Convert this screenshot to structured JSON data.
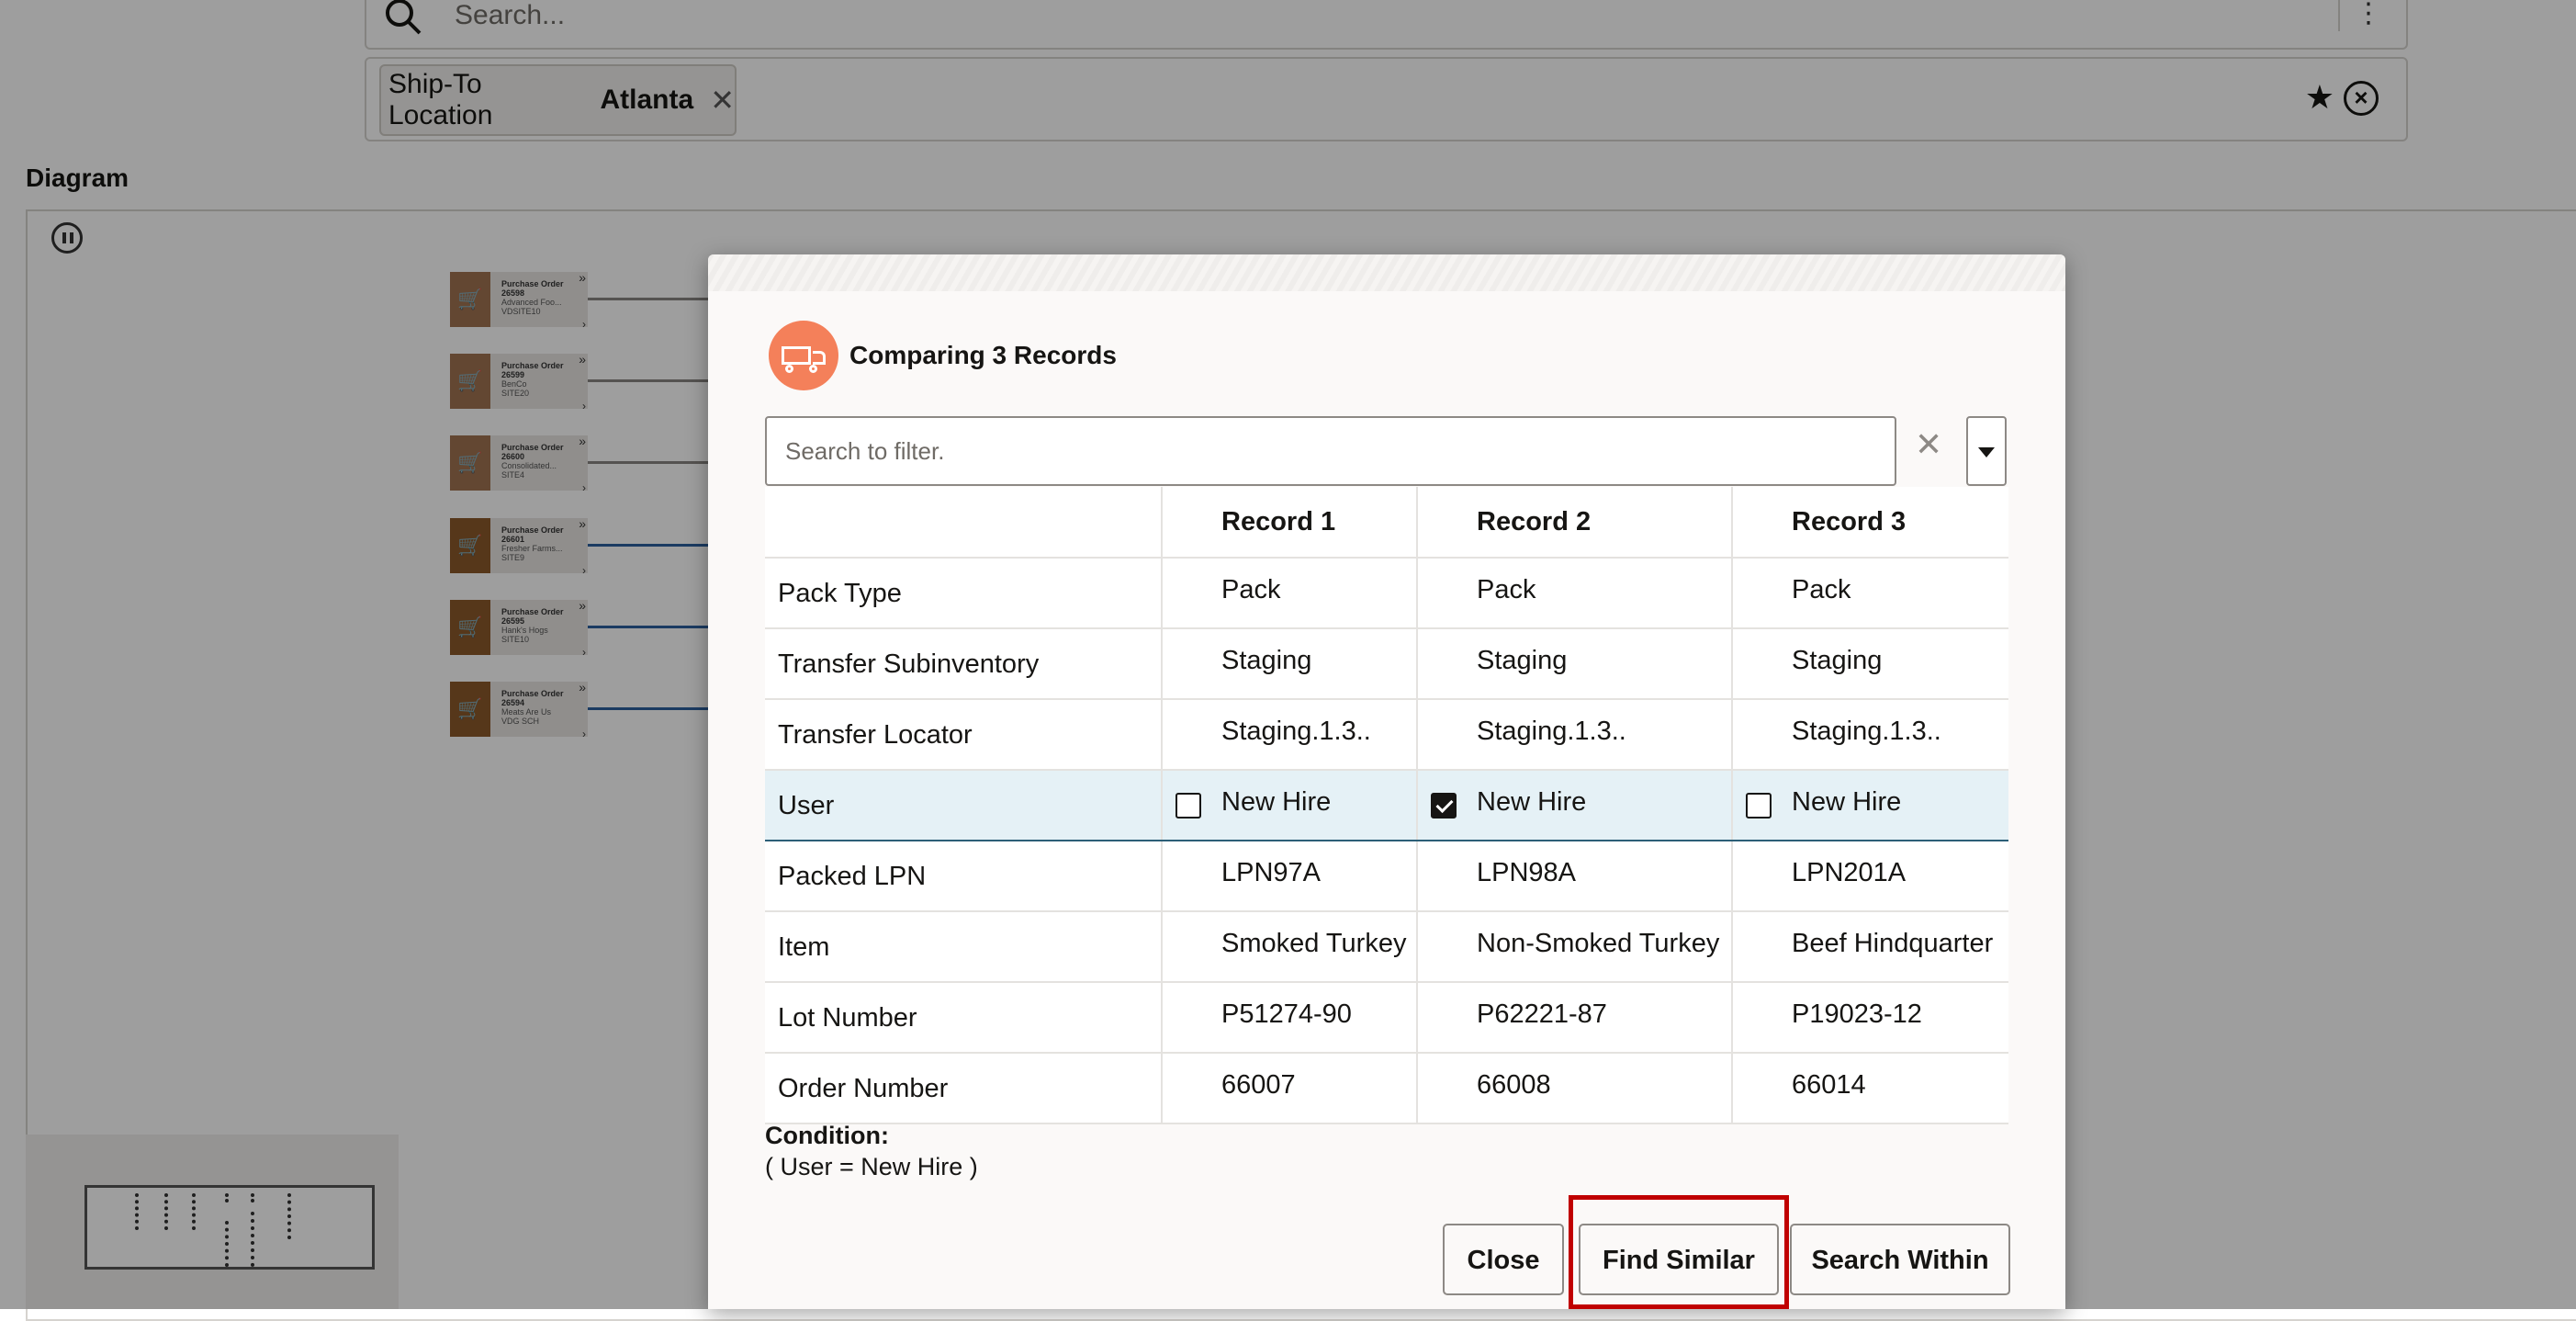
{
  "search": {
    "placeholder": "Search...",
    "menu_icon": "kebab-icon"
  },
  "filter_chip": {
    "label": "Ship-To Location",
    "value": "Atlanta"
  },
  "diagram": {
    "title": "Diagram",
    "nodes": [
      {
        "title": "Purchase Order",
        "number": "26598",
        "vendor": "Advanced Foo...",
        "site": "VDSITE10"
      },
      {
        "title": "Purchase Order",
        "number": "26599",
        "vendor": "BenCo",
        "site": "SITE20"
      },
      {
        "title": "Purchase Order",
        "number": "26600",
        "vendor": "Consolidated...",
        "site": "SITE4"
      },
      {
        "title": "Purchase Order",
        "number": "26601",
        "vendor": "Fresher Farms...",
        "site": "SITE9"
      },
      {
        "title": "Purchase Order",
        "number": "26595",
        "vendor": "Hank's Hogs",
        "site": "SITE10"
      },
      {
        "title": "Purchase Order",
        "number": "26594",
        "vendor": "Meats Are Us",
        "site": "VDG SCH"
      }
    ]
  },
  "dialog": {
    "title": "Comparing 3 Records",
    "filter_placeholder": "Search to filter.",
    "columns": [
      "",
      "Record 1",
      "Record 2",
      "Record 3"
    ],
    "rows": [
      {
        "field": "Pack Type",
        "values": [
          "Pack",
          "Pack",
          "Pack"
        ]
      },
      {
        "field": "Transfer Subinventory",
        "values": [
          "Staging",
          "Staging",
          "Staging"
        ]
      },
      {
        "field": "Transfer Locator",
        "values": [
          "Staging.1.3..",
          "Staging.1.3..",
          "Staging.1.3.."
        ]
      },
      {
        "field": "User",
        "values": [
          "New Hire",
          "New Hire",
          "New Hire"
        ],
        "checked": [
          false,
          true,
          false
        ]
      },
      {
        "field": "Packed LPN",
        "values": [
          "LPN97A",
          "LPN98A",
          "LPN201A"
        ]
      },
      {
        "field": "Item",
        "values": [
          "Smoked Turkey",
          "Non-Smoked Turkey",
          "Beef Hindquarter"
        ]
      },
      {
        "field": "Lot Number",
        "values": [
          "P51274-90",
          "P62221-87",
          "P19023-12"
        ]
      },
      {
        "field": "Order Number",
        "values": [
          "66007",
          "66008",
          "66014"
        ]
      }
    ],
    "condition_label": "Condition:",
    "condition_text": "( User = New Hire )",
    "buttons": {
      "close": "Close",
      "find_similar": "Find Similar",
      "search_within": "Search Within"
    }
  },
  "colors": {
    "accent_orange": "#f4805a",
    "highlight_red": "#c00000",
    "selected_row": "#e5f1f6",
    "node_brown": "#8b5a2b"
  }
}
